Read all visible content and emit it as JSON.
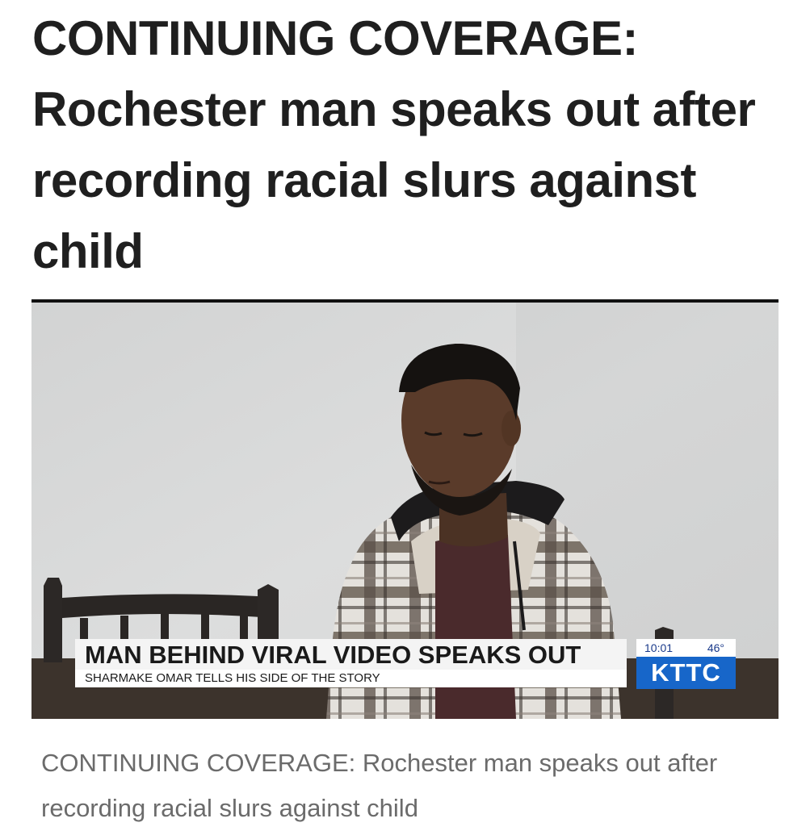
{
  "article": {
    "headline": "CONTINUING COVERAGE: Rochester man speaks out after recording racial slurs against child",
    "caption": "CONTINUING COVERAGE: Rochester man speaks out after recording racial slurs against child"
  },
  "video": {
    "lower_third": {
      "headline": "MAN BEHIND VIRAL VIDEO SPEAKS OUT",
      "subhead": "SHARMAKE OMAR TELLS HIS SIDE OF THE STORY",
      "time": "10:01",
      "temperature": "46°",
      "station": "KTTC"
    }
  },
  "colors": {
    "headline_text": "#1f1f1f",
    "caption_text": "#6b6b6b",
    "station_blue": "#1766c9",
    "wall_gray": "#d9d9d9"
  }
}
